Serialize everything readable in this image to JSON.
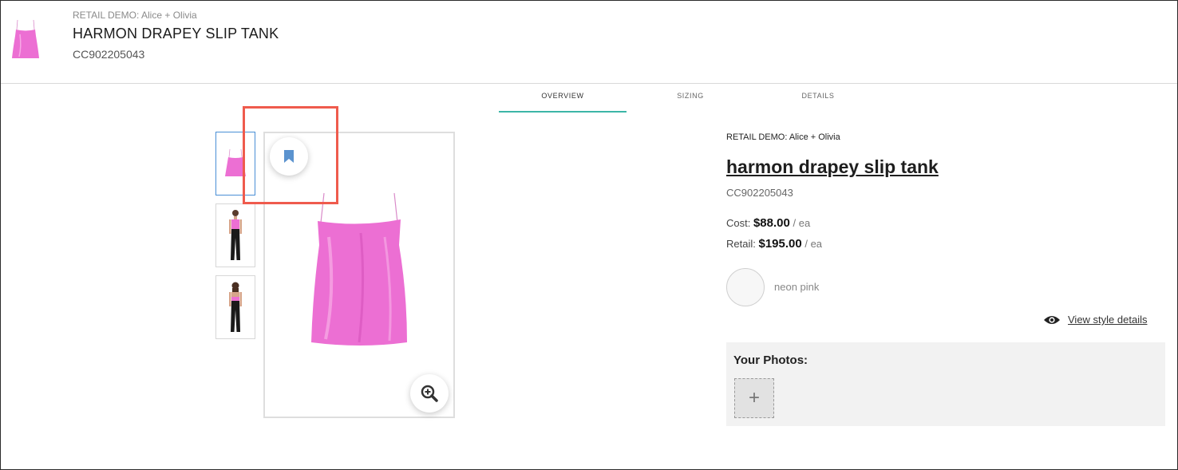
{
  "header": {
    "brand": "RETAIL DEMO: Alice + Olivia",
    "title": "HARMON DRAPEY SLIP TANK",
    "sku": "CC902205043"
  },
  "tabs": [
    {
      "label": "OVERVIEW",
      "active": true
    },
    {
      "label": "SIZING",
      "active": false
    },
    {
      "label": "DETAILS",
      "active": false
    }
  ],
  "product": {
    "brand": "RETAIL DEMO: Alice + Olivia",
    "name": "harmon drapey slip tank",
    "sku": "CC902205043",
    "cost_label": "Cost:",
    "cost_value": "$88.00",
    "retail_label": "Retail:",
    "retail_value": "$195.00",
    "unit": "/ ea",
    "color_name": "neon pink"
  },
  "links": {
    "view_style_details": "View style details"
  },
  "photos": {
    "title": "Your Photos:",
    "add_symbol": "+"
  },
  "icons": {
    "bookmark": "bookmark-icon",
    "zoom": "zoom-in-icon",
    "eye": "eye-icon"
  },
  "colors": {
    "accent_tab": "#3cb6a7",
    "bookmark_blue": "#5b93cf",
    "highlight": "#ef5b4d",
    "product_pink": "#ec6fd3"
  }
}
